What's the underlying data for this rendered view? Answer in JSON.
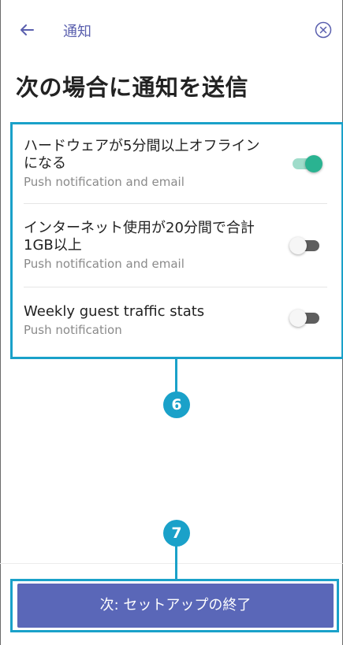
{
  "header": {
    "back_icon": "arrow-left-icon",
    "title": "通知",
    "close_icon": "close-circle-icon"
  },
  "page": {
    "heading": "次の場合に通知を送信"
  },
  "notifications": [
    {
      "title": "ハードウェアが5分間以上オフラインになる",
      "subtitle": "Push notification and email",
      "enabled": true
    },
    {
      "title": "インターネット使用が20分間で合計1GB以上",
      "subtitle": "Push notification and email",
      "enabled": false
    },
    {
      "title": "Weekly guest traffic stats",
      "subtitle": "Push notification",
      "enabled": false
    }
  ],
  "callouts": {
    "list": "6",
    "button": "7"
  },
  "footer": {
    "next_button_label": "次: セットアップの終了"
  },
  "colors": {
    "accent": "#5a67b8",
    "toggle_on": "#2ab391",
    "callout": "#1aa1c9"
  }
}
